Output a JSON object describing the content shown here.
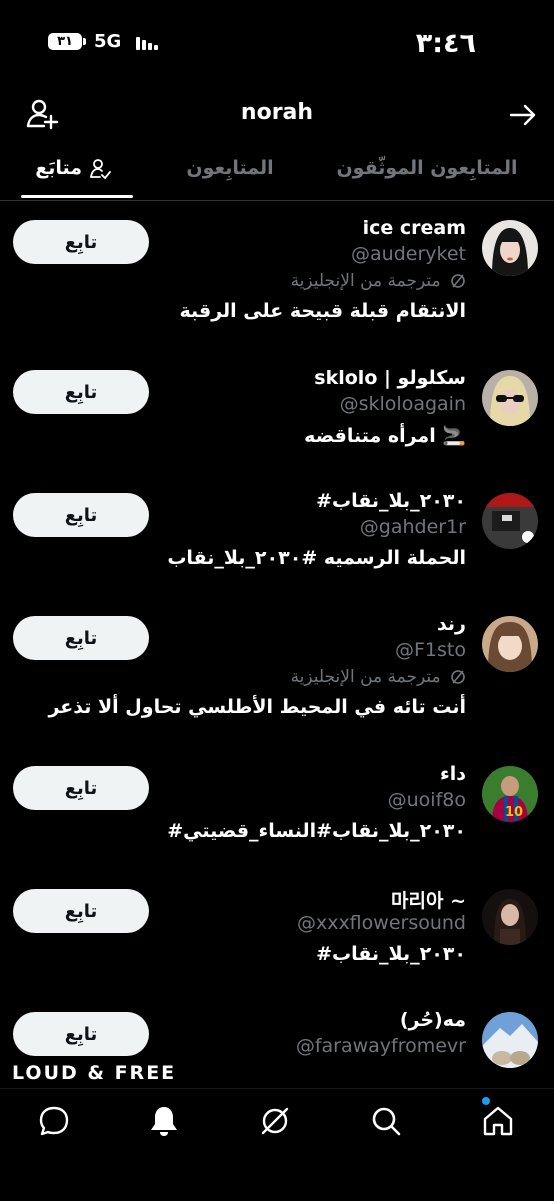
{
  "status": {
    "time": "٣:٤٦",
    "battery": "٣١",
    "network": "5G"
  },
  "header": {
    "username": "norah"
  },
  "tabs": [
    {
      "label": "المتابِعون الموثّقون"
    },
    {
      "label": "المتابِعون"
    },
    {
      "label": "متابَع"
    }
  ],
  "follow_label": "تابِع",
  "translated_label": "مترجمة من الإنجليزية",
  "users": [
    {
      "name": "ice cream",
      "handle": "@auderyket",
      "translated": true,
      "bio": "الانتقام قبلة قبيحة على الرقبة"
    },
    {
      "name": "sklolo | سكلولو",
      "handle": "@skloloagain",
      "translated": false,
      "bio": "امرأه متناقضه 🚬"
    },
    {
      "name": "#٢٠٣٠_بلا_نقاب",
      "handle": "@gahder1r",
      "translated": false,
      "bio": "الحملة الرسميه #٢٠٣٠_بلا_نقاب"
    },
    {
      "name": "رند",
      "handle": "@F1sto",
      "translated": true,
      "bio": "أنت تائه في المحيط الأطلسي تحاول ألا تذعر"
    },
    {
      "name": "داء",
      "handle": "@uoif8o",
      "translated": false,
      "bio": "#٢٠٣٠_بلا_نقاب#النساء_قضيتي"
    },
    {
      "name": "마리아 ~",
      "handle": "@xxxflowersound",
      "translated": false,
      "bio": "#٢٠٣٠_بلا_نقاب"
    },
    {
      "name": "(حُر)مه",
      "handle": "@farawayfromevr",
      "translated": false,
      "bio": ""
    }
  ],
  "partial_text": "LOUD & FREE",
  "colors": {
    "background": "#000000",
    "text": "#e7e9ea",
    "muted": "#71767b",
    "button_bg": "#eff3f4",
    "accent": "#1d9bf0"
  },
  "nav": [
    "home-icon",
    "search-icon",
    "grok-icon",
    "notifications-icon",
    "messages-icon"
  ]
}
